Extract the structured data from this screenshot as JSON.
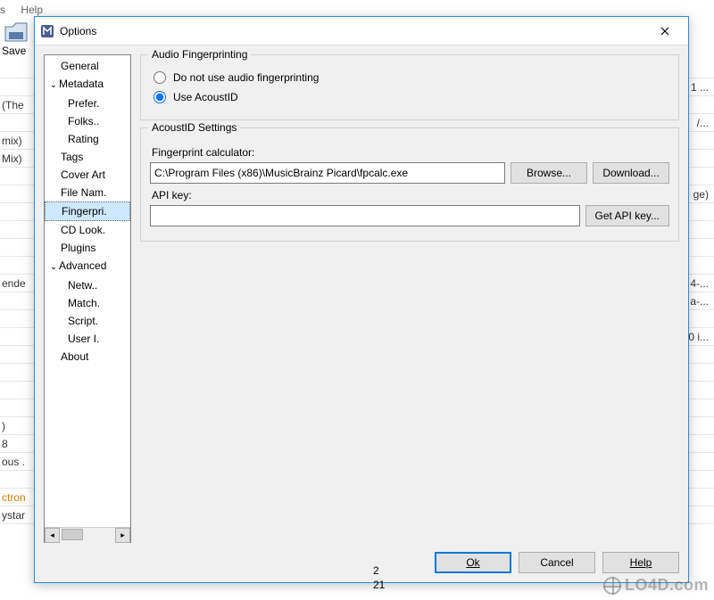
{
  "bg": {
    "menu": [
      "s",
      "Help"
    ],
    "save_label": "Save",
    "left_rows": [
      "",
      "",
      "(The",
      "",
      "mix)",
      "Mix)",
      "",
      "",
      "",
      "",
      "",
      "",
      "ende",
      "",
      "",
      "",
      "",
      "",
      "",
      "",
      ")",
      "8",
      "ous .",
      "",
      "ctron",
      "ystar"
    ],
    "right_rows": [
      "",
      "1 ...",
      "",
      "/...",
      "",
      "",
      "",
      "ge)",
      "",
      "",
      "",
      "",
      "4-...",
      "a-...",
      "",
      "0 i...",
      "",
      "",
      "",
      "",
      "",
      "",
      "",
      "",
      "",
      ""
    ],
    "bottom_numbers": [
      "2",
      "21"
    ]
  },
  "dialog": {
    "title": "Options",
    "tree": [
      {
        "label": "General",
        "level": 0
      },
      {
        "label": "Metadata",
        "level": 0,
        "expanded": true
      },
      {
        "label": "Prefer.",
        "level": 1
      },
      {
        "label": "Folks..",
        "level": 1
      },
      {
        "label": "Rating",
        "level": 1
      },
      {
        "label": "Tags",
        "level": 0
      },
      {
        "label": "Cover Art",
        "level": 0
      },
      {
        "label": "File Nam.",
        "level": 0
      },
      {
        "label": "Fingerpri.",
        "level": 0,
        "selected": true
      },
      {
        "label": "CD Look.",
        "level": 0
      },
      {
        "label": "Plugins",
        "level": 0
      },
      {
        "label": "Advanced",
        "level": 0,
        "expanded": true
      },
      {
        "label": "Netw..",
        "level": 1
      },
      {
        "label": "Match.",
        "level": 1
      },
      {
        "label": "Script.",
        "level": 1
      },
      {
        "label": "User I.",
        "level": 1
      },
      {
        "label": "About",
        "level": 0
      }
    ],
    "fingerprinting": {
      "legend": "Audio Fingerprinting",
      "opt_none": "Do not use audio fingerprinting",
      "opt_acoustid": "Use AcoustID",
      "selected": "acoustid"
    },
    "acoustid": {
      "legend": "AcoustID Settings",
      "calc_label": "Fingerprint calculator:",
      "calc_value": "C:\\Program Files (x86)\\MusicBrainz Picard\\fpcalc.exe",
      "browse": "Browse...",
      "download": "Download...",
      "apikey_label": "API key:",
      "apikey_value": "",
      "get_apikey": "Get API key..."
    },
    "buttons": {
      "ok": "Ok",
      "cancel": "Cancel",
      "help": "Help"
    }
  },
  "watermark": "LO4D.com"
}
